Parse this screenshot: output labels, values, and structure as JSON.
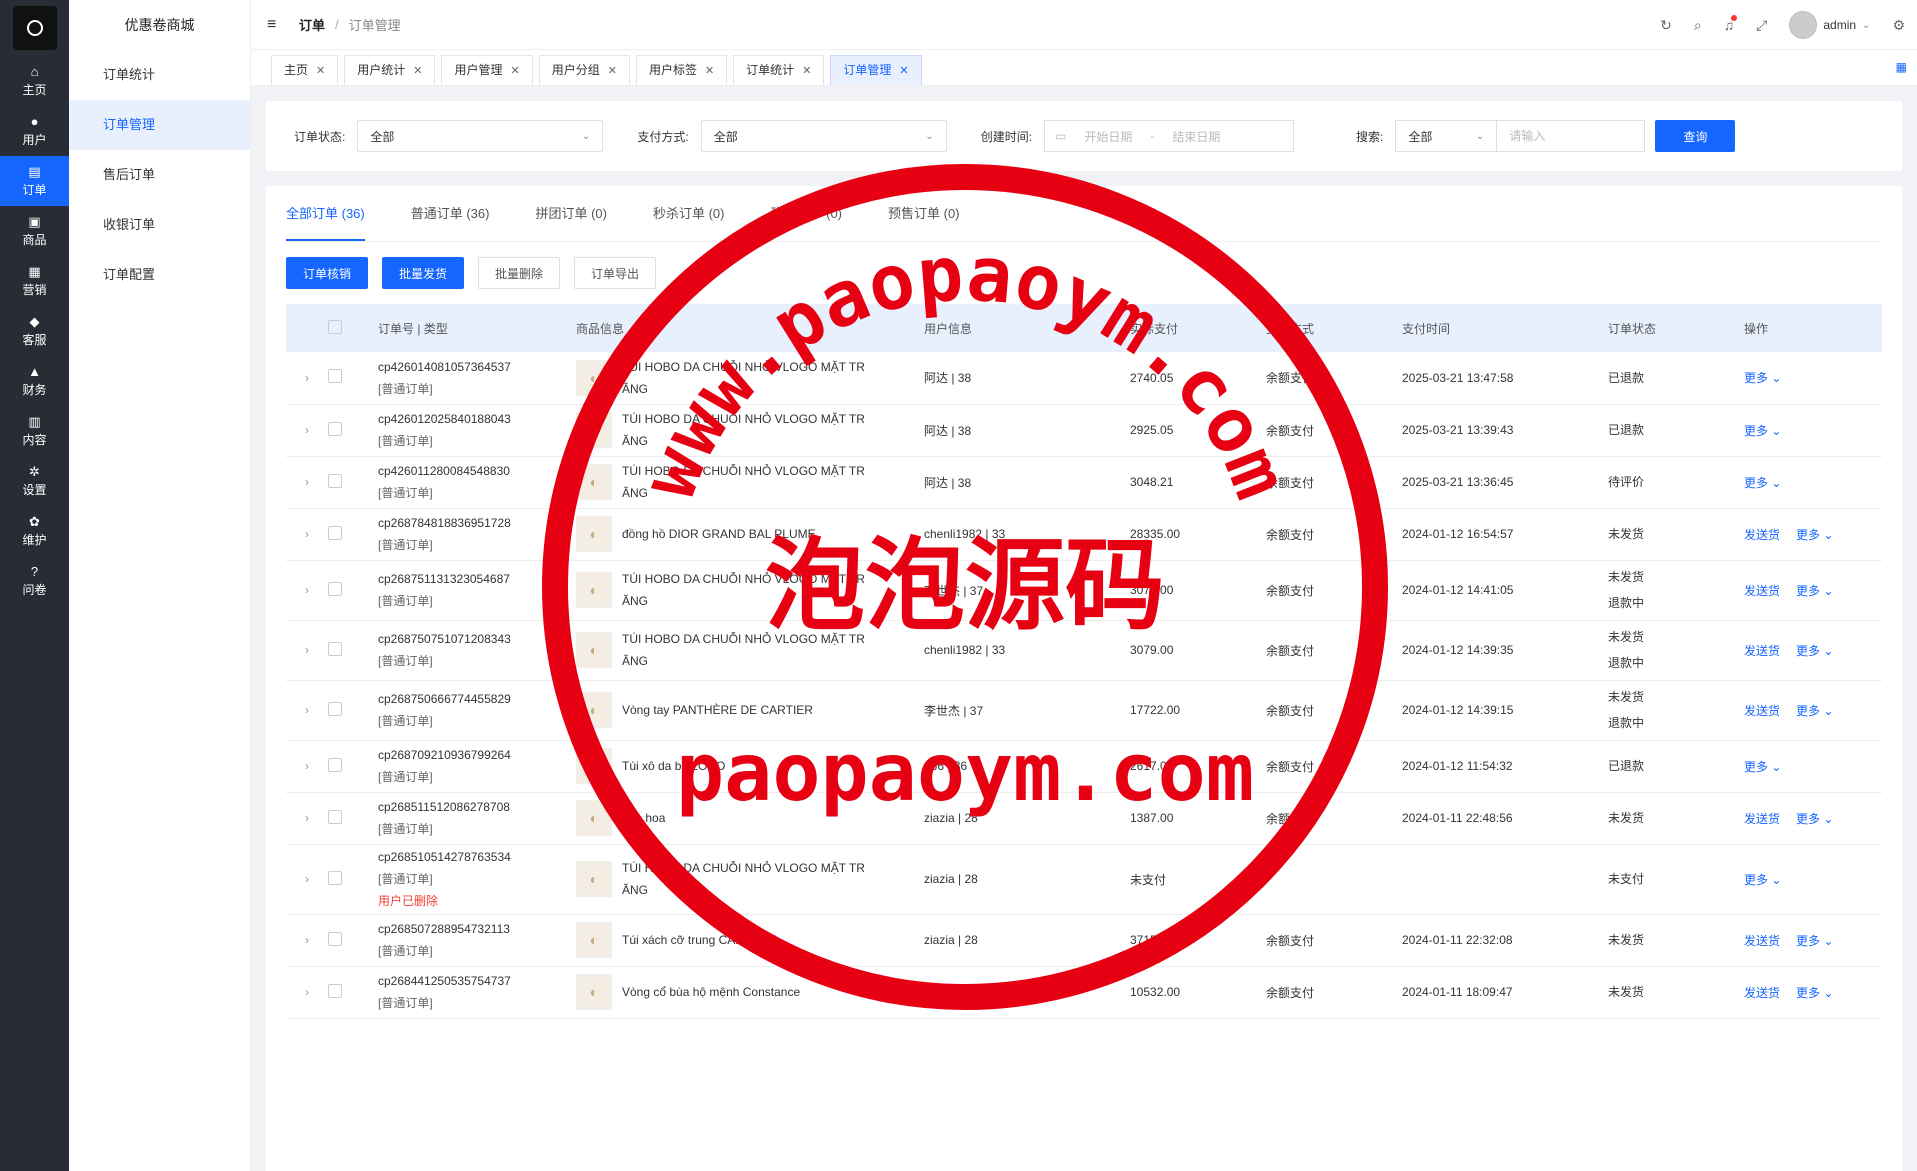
{
  "brand": {
    "name": "优惠卷商城"
  },
  "rail": [
    {
      "label": "主页",
      "icon": "⌂"
    },
    {
      "label": "用户",
      "icon": "●"
    },
    {
      "label": "订单",
      "icon": "▤"
    },
    {
      "label": "商品",
      "icon": "▣"
    },
    {
      "label": "营销",
      "icon": "▦"
    },
    {
      "label": "客服",
      "icon": "◆"
    },
    {
      "label": "财务",
      "icon": "▲"
    },
    {
      "label": "内容",
      "icon": "▥"
    },
    {
      "label": "设置",
      "icon": "✲"
    },
    {
      "label": "维护",
      "icon": "✿"
    },
    {
      "label": "问卷",
      "icon": "?"
    }
  ],
  "submenu": [
    "订单统计",
    "订单管理",
    "售后订单",
    "收银订单",
    "订单配置"
  ],
  "header": {
    "breadcrumb_main": "订单",
    "breadcrumb_sub": "订单管理",
    "user": "admin"
  },
  "tabs": [
    "主页",
    "用户统计",
    "用户管理",
    "用户分组",
    "用户标签",
    "订单统计",
    "订单管理"
  ],
  "filter": {
    "status_label": "订单状态:",
    "status_value": "全部",
    "pay_label": "支付方式:",
    "pay_value": "全部",
    "time_label": "创建时间:",
    "start_placeholder": "开始日期",
    "end_placeholder": "结束日期",
    "range_sep": "-",
    "search_label": "搜索:",
    "search_scope": "全部",
    "search_placeholder": "请输入",
    "query_button": "查询"
  },
  "order_tabs": [
    "全部订单 (36)",
    "普通订单 (36)",
    "拼团订单 (0)",
    "秒杀订单 (0)",
    "砍价订单 (0)",
    "预售订单 (0)"
  ],
  "actions": [
    "订单核销",
    "批量发货",
    "批量删除",
    "订单导出"
  ],
  "columns": [
    "订单号 | 类型",
    "商品信息",
    "用户信息",
    "实际支付",
    "支付方式",
    "支付时间",
    "订单状态",
    "操作"
  ],
  "rows": [
    {
      "id": "cp426014081057364537",
      "type": "[普通订单]",
      "product": "TÚI HOBO DA CHUỖI NHỎ VLOGO MẶT TR ĂNG",
      "user": "阿达 | 38",
      "paid": "2740.05",
      "method": "余额支付",
      "time": "2025-03-21 13:47:58",
      "status": "已退款",
      "status2": "",
      "ship": "",
      "more": "更多"
    },
    {
      "id": "cp426012025840188043",
      "type": "[普通订单]",
      "product": "TÚI HOBO DA CHUỖI NHỎ VLOGO MẶT TR ĂNG",
      "user": "阿达 | 38",
      "paid": "2925.05",
      "method": "余额支付",
      "time": "2025-03-21 13:39:43",
      "status": "已退款",
      "status2": "",
      "ship": "",
      "more": "更多"
    },
    {
      "id": "cp426011280084548830",
      "type": "[普通订单]",
      "product": "TÚI HOBO DA CHUỖI NHỎ VLOGO MẶT TR ĂNG",
      "user": "阿达 | 38",
      "paid": "3048.21",
      "method": "余额支付",
      "time": "2025-03-21 13:36:45",
      "status": "待评价",
      "status2": "",
      "ship": "",
      "more": "更多"
    },
    {
      "id": "cp268784818836951728",
      "type": "[普通订单]",
      "product": "đồng hồ DIOR GRAND BAL PLUME",
      "user": "chenli1982 | 33",
      "paid": "28335.00",
      "method": "余额支付",
      "time": "2024-01-12 16:54:57",
      "status": "未发货",
      "status2": "",
      "ship": "发送货",
      "more": "更多"
    },
    {
      "id": "cp268751131323054687",
      "type": "[普通订单]",
      "product": "TÚI HOBO DA CHUỖI NHỎ VLOGO MẶT TR ĂNG",
      "user": "李世杰 | 37",
      "paid": "3079.00",
      "method": "余额支付",
      "time": "2024-01-12 14:41:05",
      "status": "未发货",
      "status2": "退款中",
      "ship": "发送货",
      "more": "更多"
    },
    {
      "id": "cp268750751071208343",
      "type": "[普通订单]",
      "product": "TÚI HOBO DA CHUỖI NHỎ VLOGO MẶT TR ĂNG",
      "user": "chenli1982 | 33",
      "paid": "3079.00",
      "method": "余额支付",
      "time": "2024-01-12 14:39:35",
      "status": "未发货",
      "status2": "退款中",
      "ship": "发送货",
      "more": "更多"
    },
    {
      "id": "cp268750666774455829",
      "type": "[普通订单]",
      "product": "Vòng tay PANTHÈRE DE CARTIER",
      "user": "李世杰 | 37",
      "paid": "17722.00",
      "method": "余额支付",
      "time": "2024-01-12 14:39:15",
      "status": "未发货",
      "status2": "退款中",
      "ship": "发送货",
      "more": "更多"
    },
    {
      "id": "cp268709210936799264",
      "type": "[普通订单]",
      "product": "Túi xô da bê LOCO",
      "user": "166 | 36",
      "paid": "2617.00",
      "method": "余额支付",
      "time": "2024-01-12 11:54:32",
      "status": "已退款",
      "status2": "",
      "ship": "",
      "more": "更多"
    },
    {
      "id": "cp268511512086278708",
      "type": "[普通订单]",
      "product": "dép hoa",
      "user": "ziazia | 28",
      "paid": "1387.00",
      "method": "余额支付",
      "time": "2024-01-11 22:48:56",
      "status": "未发货",
      "status2": "",
      "ship": "发送货",
      "more": "更多"
    },
    {
      "id": "cp268510514278763534",
      "type": "[普通订单]",
      "deleted": "用户已删除",
      "product": "TÚI HOBO DA CHUỖI NHỎ VLOGO MẶT TR ĂNG",
      "user": "ziazia | 28",
      "paid": "未支付",
      "method": "",
      "time": "",
      "status": "未支付",
      "status2": "",
      "ship": "",
      "more": "更多"
    },
    {
      "id": "cp268507288954732113",
      "type": "[普通订单]",
      "product": "Túi xách cỡ trung CARRYALL",
      "user": "ziazia | 28",
      "paid": "3715.00",
      "method": "余额支付",
      "time": "2024-01-11 22:32:08",
      "status": "未发货",
      "status2": "",
      "ship": "发送货",
      "more": "更多"
    },
    {
      "id": "cp268441250535754737",
      "type": "[普通订单]",
      "product": "Vòng cổ bùa hộ mệnh Constance",
      "user": "166 | 36",
      "paid": "10532.00",
      "method": "余额支付",
      "time": "2024-01-11 18:09:47",
      "status": "未发货",
      "status2": "",
      "ship": "发送货",
      "more": "更多"
    }
  ],
  "watermark": {
    "arc_text": "www.paopaoym.com",
    "center": "泡泡源码",
    "bottom": "paopaoym.com",
    "color": "#e60012"
  }
}
